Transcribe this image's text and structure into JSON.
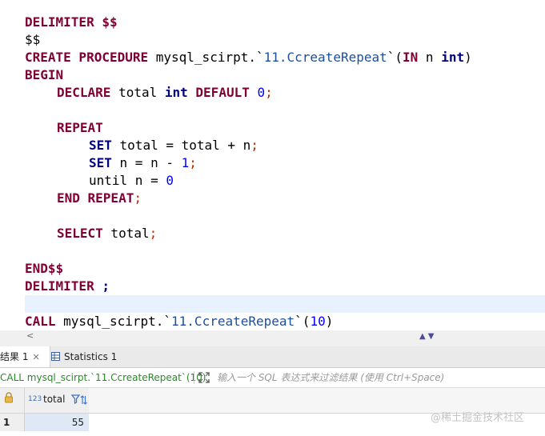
{
  "editor": {
    "line1": {
      "kw": "DELIMITER",
      "rest": " $$"
    },
    "line2": {
      "text": "$$"
    },
    "line3": {
      "kw1": "CREATE PROCEDURE",
      "schema": " mysql_scirpt.",
      "bq_open": "`",
      "proc": "11.CcreateRepeat",
      "bq_close": "`",
      "lp": "(",
      "in_kw": "IN",
      "param": " n ",
      "type_kw": "int",
      "rp": ")"
    },
    "line4": {
      "kw": "BEGIN"
    },
    "line5": {
      "kw": "DECLARE",
      "id": " total ",
      "type_kw": "int",
      "default_kw": " DEFAULT ",
      "num": "0",
      "semi": ";"
    },
    "line6": {
      "kw": "REPEAT"
    },
    "line7": {
      "kw": "SET",
      "expr": " total = total + n",
      "semi": ";"
    },
    "line8": {
      "kw": "SET",
      "expr": " n = n - ",
      "num": "1",
      "semi": ";"
    },
    "line9": {
      "expr": "until n = ",
      "num": "0"
    },
    "line10": {
      "kw": "END REPEAT",
      "semi": ";"
    },
    "line11": {
      "kw": "SELECT",
      "expr": " total",
      "semi": ";"
    },
    "line12": {
      "kw": "END$$"
    },
    "line13": {
      "kw": "DELIMITER ",
      "semi": ";"
    },
    "line14": {
      "kw": "CALL",
      "schema": " mysql_scirpt.",
      "bq_open": "`",
      "proc": "11.CcreateRepeat",
      "bq_close": "`",
      "lp": "(",
      "num": "10",
      "rp": ")"
    }
  },
  "scrollbar": {
    "left_arrow": "<",
    "sort_arrows": "▲▼"
  },
  "tabs": {
    "results_label": "结果 1",
    "results_close": "✕",
    "statistics_label": "Statistics 1"
  },
  "filter": {
    "query_text": "CALL mysql_scirpt.`11.CcreateRepeat`(10)",
    "placeholder": "输入一个 SQL 表达式来过滤结果 (使用 Ctrl+Space)"
  },
  "results": {
    "columns": [
      {
        "type_badge": "123",
        "name": "total"
      }
    ],
    "rows": [
      {
        "row_number": "1",
        "total": "55"
      }
    ]
  },
  "watermark": "@稀土掘金技术社区",
  "colors": {
    "keyword": "#7f0033",
    "keyword_type": "#00007f",
    "number": "#0000ff",
    "punct": "#bb2b00",
    "backtick_name": "#1d4f9a",
    "query_green": "#2a8a2a",
    "selection": "#dfe9f6"
  }
}
